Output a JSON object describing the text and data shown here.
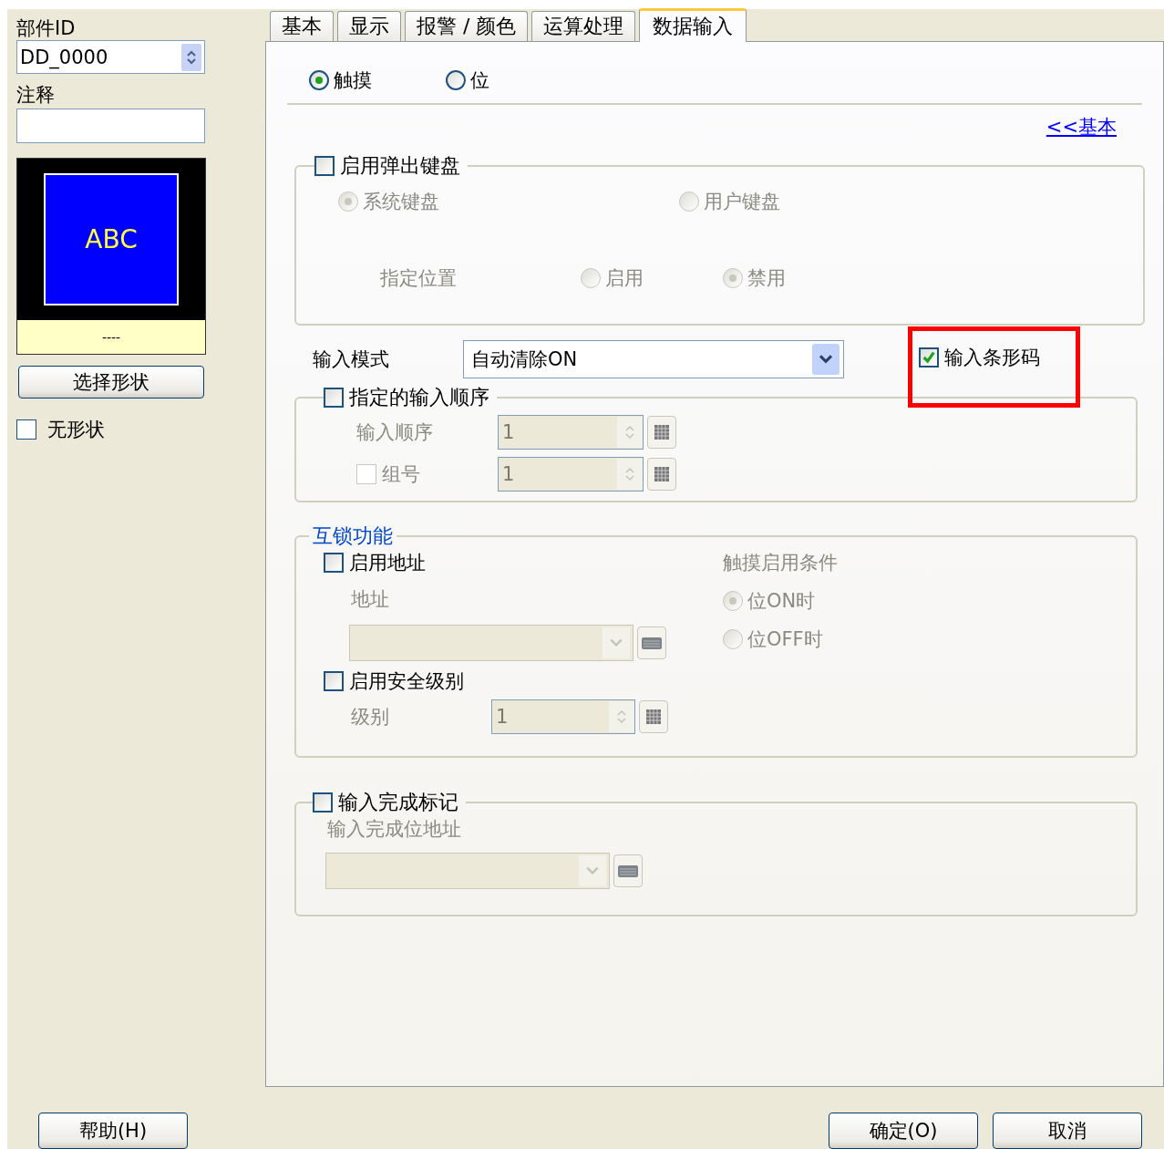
{
  "sidebar": {
    "part_id_label": "部件ID",
    "part_id": "DD_0000",
    "comment_label": "注释",
    "preview_text": "ABC",
    "preview_caption": "----",
    "select_shape_button": "选择形状",
    "no_shape": {
      "label": "无形状",
      "checked": false
    }
  },
  "tabs": [
    {
      "label": "基本",
      "selected": false
    },
    {
      "label": "显示",
      "selected": false
    },
    {
      "label": "报警 / 颜色",
      "selected": false
    },
    {
      "label": "运算处理",
      "selected": false
    },
    {
      "label": "数据输入",
      "selected": true
    }
  ],
  "mode_options": [
    {
      "label": "触摸",
      "selected": true
    },
    {
      "label": "位",
      "selected": false
    }
  ],
  "basic_link": "<<基本",
  "popup_keyboard": {
    "label": "启用弹出键盘",
    "checked": false,
    "keyboards": [
      {
        "label": "系统键盘",
        "selected": true
      },
      {
        "label": "用户键盘",
        "selected": false
      }
    ],
    "position_label": "指定位置",
    "position_options": [
      {
        "label": "启用",
        "selected": false
      },
      {
        "label": "禁用",
        "selected": true
      }
    ]
  },
  "input_mode": {
    "label": "输入模式",
    "value": "自动清除ON"
  },
  "barcode": {
    "label": "输入条形码",
    "checked": true,
    "highlighted": true
  },
  "input_order": {
    "label": "指定的输入顺序",
    "checked": false,
    "order_label": "输入顺序",
    "order_value": "1",
    "group": {
      "label": "组号",
      "checked": false,
      "value": "1"
    }
  },
  "interlock": {
    "title": "互锁功能",
    "enable_address": {
      "label": "启用地址",
      "checked": false
    },
    "address_label": "地址",
    "condition_label": "触摸启用条件",
    "conditions": [
      {
        "label": "位ON时",
        "selected": true
      },
      {
        "label": "位OFF时",
        "selected": false
      }
    ],
    "security": {
      "label": "启用安全级别",
      "checked": false
    },
    "level_label": "级别",
    "level_value": "1"
  },
  "completion": {
    "label": "输入完成标记",
    "checked": false,
    "address_label": "输入完成位地址"
  },
  "buttons": {
    "help": "帮助(H)",
    "ok": "确定(O)",
    "cancel": "取消"
  }
}
